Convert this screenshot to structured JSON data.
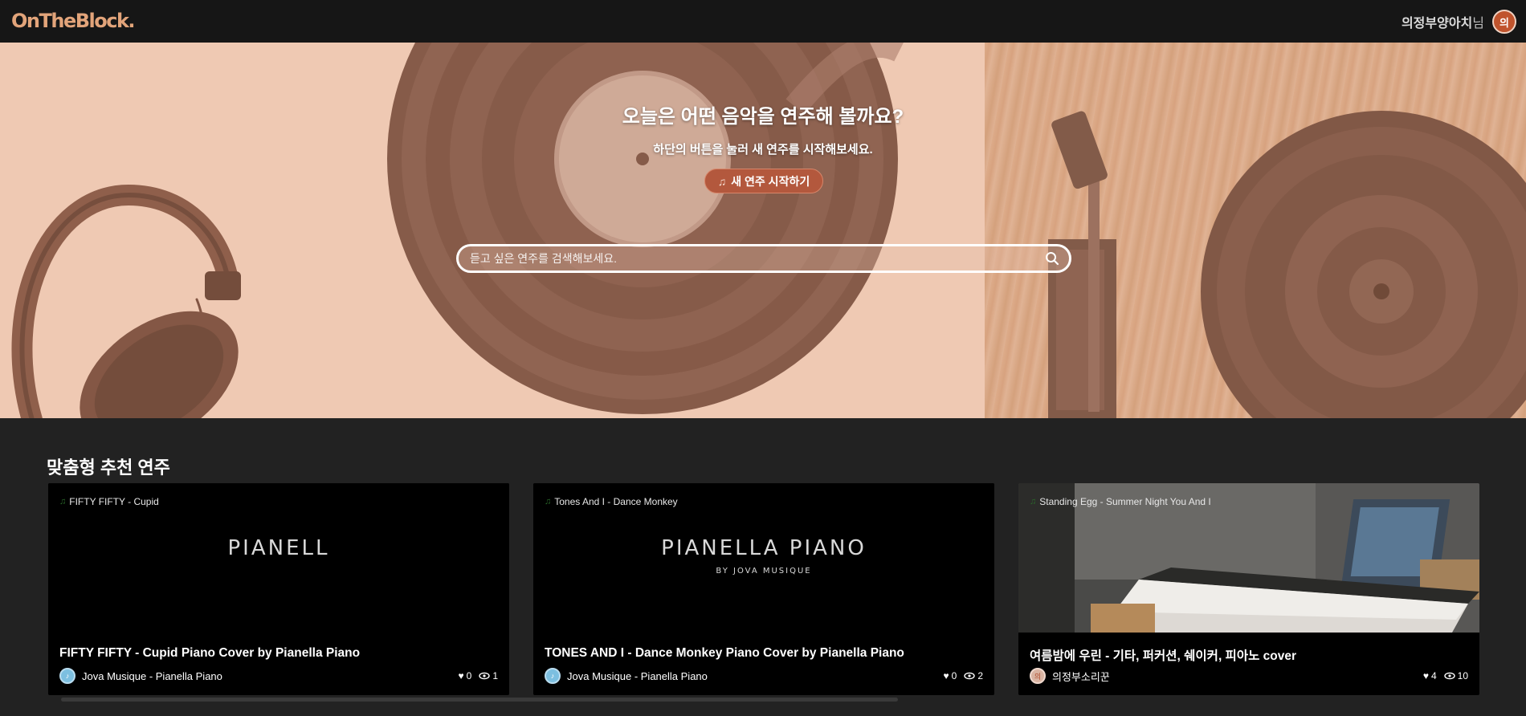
{
  "header": {
    "logo": "OnTheBlock.",
    "username": "의정부양아치",
    "username_suffix": "님",
    "avatar_initial": "의"
  },
  "hero": {
    "title": "오늘은 어떤 음악을 연주해 볼까요?",
    "subtitle": "하단의 버튼을 눌러 새 연주를 시작해보세요.",
    "start_button": "새 연주 시작하기",
    "search_placeholder": "듣고 싶은 연주를 검색해보세요."
  },
  "recommended": {
    "section_title": "맞춤형 추천 연주",
    "cards": [
      {
        "thumb_label": "FIFTY FIFTY - Cupid",
        "thumb_wordmark": "PIANELL",
        "title": "FIFTY FIFTY - Cupid Piano Cover by Pianella Piano",
        "author": "Jova Musique - Pianella Piano",
        "likes": "0",
        "views": "1"
      },
      {
        "thumb_label": "Tones And I - Dance Monkey",
        "thumb_wordmark": "PIANELLA PIANO",
        "thumb_wordmark_sub": "BY JOVA MUSIQUE",
        "title": "TONES AND I - Dance Monkey Piano Cover by Pianella Piano",
        "author": "Jova Musique - Pianella Piano",
        "likes": "0",
        "views": "2"
      },
      {
        "thumb_label": "Standing Egg - Summer Night You And I",
        "title": "여름밤에 우린 - 기타, 퍼커션, 쉐이커, 피아노 cover",
        "author": "의정부소리꾼",
        "author_avatar_initial": "의",
        "likes": "4",
        "views": "10"
      }
    ]
  },
  "colors": {
    "brand_orange": "#e2a47a",
    "accent_button": "#b3583d",
    "header_bg": "#161616",
    "page_bg": "#222222"
  }
}
